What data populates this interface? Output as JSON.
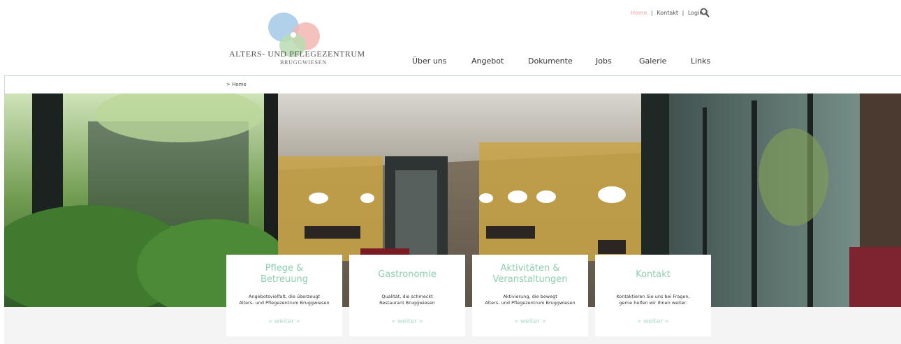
{
  "logo": {
    "name": "Alters- und Pflegezentrum",
    "sub": "BRUGGWIESEN"
  },
  "topnav": {
    "home": "Home",
    "kontakt": "Kontakt",
    "login": "Login",
    "sep": "|"
  },
  "mainnav": [
    "Über uns",
    "Angebot",
    "Dokumente",
    "Jobs",
    "Galerie",
    "Links"
  ],
  "breadcrumb": "> Home",
  "cards": [
    {
      "title1": "Pflege &",
      "title2": "Betreuung",
      "text1": "Angebotsvielfalt, die überzeugt",
      "text2": "Alters- und Pflegezentrum Bruggwiesen",
      "more": "» weiter »"
    },
    {
      "title1": "Gastronomie",
      "title2": "",
      "text1": "Qualität, die schmeckt",
      "text2": "Restaurant Bruggwiesen",
      "more": "» weiter »"
    },
    {
      "title1": "Aktivitäten &",
      "title2": "Veranstaltungen",
      "text1": "Aktivierung, die bewegt",
      "text2": "Alters- und Pflegezentrum Bruggwiesen",
      "more": "» weiter »"
    },
    {
      "title1": "Kontakt",
      "title2": "",
      "text1": "Kontaktieren Sie uns bei Fragen,",
      "text2": "gerne helfen wir Ihnen weiter.",
      "more": "» weiter «"
    }
  ],
  "colors": {
    "accent_green": "#8dcfb0",
    "accent_pink": "#f0a9a6"
  }
}
